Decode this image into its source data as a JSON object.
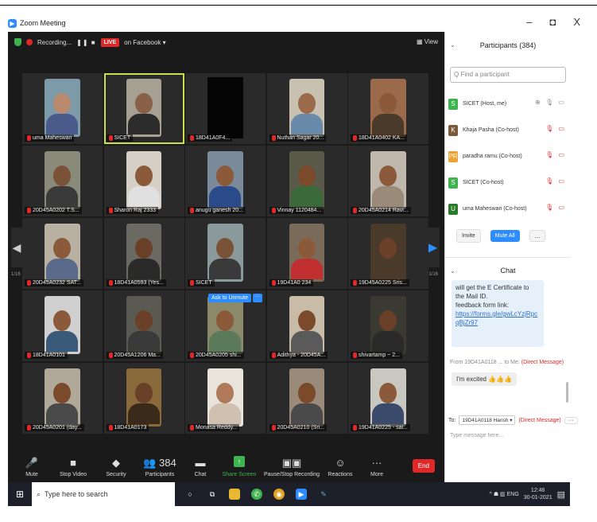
{
  "window": {
    "title": "Zoom Meeting",
    "minimize": "–",
    "maximize": "◘",
    "close": "X"
  },
  "meeting_top": {
    "recording_label": "Recording...",
    "pause_stop": "❚❚ ■",
    "live_badge": "LIVE",
    "live_target": "on Facebook ▾",
    "view_label": "▦ View"
  },
  "nav": {
    "left_page": "1/16",
    "right_page": "1/16",
    "left_arrow": "◀",
    "right_arrow": "▶"
  },
  "tiles": [
    {
      "name": "uma Maheswari",
      "kind": "photo",
      "skin": "#b98a6e",
      "shirt": "#4a5a8a",
      "bg": "#7d9aa8"
    },
    {
      "name": "SICET",
      "kind": "photo",
      "skin": "#8a6048",
      "shirt": "#2c2c2c",
      "bg": "#a6a092",
      "active": true
    },
    {
      "name": "18D41A0F4...",
      "kind": "black"
    },
    {
      "name": "Nuthan Sagar 20...",
      "kind": "photo",
      "skin": "#9a6a4a",
      "shirt": "#6a8aaa",
      "bg": "#c8c0b0"
    },
    {
      "name": "18D41A0402 KA...",
      "kind": "photo",
      "skin": "#8a5a3a",
      "shirt": "#4a3a2a",
      "bg": "#9a6a4a"
    },
    {
      "name": "20D45A0202 T.S...",
      "kind": "photo",
      "skin": "#7a5238",
      "shirt": "#3a3a3a",
      "bg": "#8a8a7a"
    },
    {
      "name": "Sharon Raj 2333",
      "kind": "photo",
      "skin": "#8a5a3a",
      "shirt": "#e0e0e0",
      "bg": "#d6cfc6"
    },
    {
      "name": "anugu ganesh 20...",
      "kind": "photo",
      "skin": "#8a5a3a",
      "shirt": "#2a4a8a",
      "bg": "#7a8a9a"
    },
    {
      "name": "Vinnay 1120484...",
      "kind": "photo",
      "skin": "#7a4a2a",
      "shirt": "#3a6a3a",
      "bg": "#5a5a4a"
    },
    {
      "name": "20D45A0214 Ravi...",
      "kind": "photo",
      "skin": "#8a5a3a",
      "shirt": "#9a8a7a",
      "bg": "#c0b8ac"
    },
    {
      "name": "20D45A0232 SAT...",
      "kind": "photo",
      "skin": "#8a5a3a",
      "shirt": "#5a6a8a",
      "bg": "#b8b0a0"
    },
    {
      "name": "18D41A0593 (Yes...",
      "kind": "photo",
      "skin": "#6a4028",
      "shirt": "#2a2a2a",
      "bg": "#6a6a62"
    },
    {
      "name": "SICET",
      "kind": "photo",
      "skin": "#7a5238",
      "shirt": "#3a3a3a",
      "bg": "#8a9a9a"
    },
    {
      "name": "19D41A0 234",
      "kind": "photo",
      "skin": "#8a5a3a",
      "shirt": "#c03030",
      "bg": "#7a6a5a"
    },
    {
      "name": "19D45A0225 Sris...",
      "kind": "photo",
      "skin": "#6a4028",
      "shirt": "#4a3a2a",
      "bg": "#4a3a2a"
    },
    {
      "name": "18D41A0101",
      "kind": "photo",
      "skin": "#8a5a3a",
      "shirt": "#3a5a7a",
      "bg": "#d0d0d0"
    },
    {
      "name": "20D45A1206 Ma...",
      "kind": "photo",
      "skin": "#6a4028",
      "shirt": "#3a3a3a",
      "bg": "#5a5a52"
    },
    {
      "name": "20D45A0205 shi...",
      "kind": "photo",
      "skin": "#8a5a3a",
      "shirt": "#5a7a5a",
      "bg": "#8a8a6a",
      "unmute": true
    },
    {
      "name": "Adithya - 20D45A...",
      "kind": "photo",
      "skin": "#7a4a2a",
      "shirt": "#5a5a5a",
      "bg": "#c8bca8"
    },
    {
      "name": "shivartamp ~ 2...",
      "kind": "photo",
      "skin": "#6a4028",
      "shirt": "#2a2a2a",
      "bg": "#3a3a32"
    },
    {
      "name": "20D45A0201 (day...",
      "kind": "photo",
      "skin": "#7a4a2a",
      "shirt": "#4a4a4a",
      "bg": "#b0a898"
    },
    {
      "name": "18D41A0173",
      "kind": "photo",
      "skin": "#6a4028",
      "shirt": "#3a2a1a",
      "bg": "#8a6a3a"
    },
    {
      "name": "Monasa Reddy...",
      "kind": "photo",
      "skin": "#b07a5a",
      "shirt": "#d0c0b0",
      "bg": "#e8e4dc"
    },
    {
      "name": "20D45A0210 (Sri...",
      "kind": "photo",
      "skin": "#7a4a2a",
      "shirt": "#4a4a4a",
      "bg": "#9a8a7a"
    },
    {
      "name": "19D41A0225 - sai...",
      "kind": "photo",
      "skin": "#8a5a3a",
      "shirt": "#3a4a6a",
      "bg": "#c8c8c0"
    }
  ],
  "unmute": {
    "label": "Ask to Unmute",
    "more": "···"
  },
  "toolbar": [
    {
      "icon": "🎤",
      "label": "Mute",
      "name": "mute-button"
    },
    {
      "icon": "■",
      "label": "Stop Video",
      "name": "stop-video-button"
    },
    {
      "icon": "◆",
      "label": "Security",
      "name": "security-button"
    },
    {
      "icon": "👥 384",
      "label": "Participants",
      "name": "participants-button"
    },
    {
      "icon": "▬",
      "label": "Chat",
      "name": "chat-button"
    },
    {
      "icon": "↑",
      "label": "Share Screen",
      "name": "share-screen-button",
      "green": true
    },
    {
      "icon": "▣▣",
      "label": "Pause/Stop Recording",
      "name": "pause-stop-recording-button"
    },
    {
      "icon": "☺",
      "label": "Reactions",
      "name": "reactions-button"
    },
    {
      "icon": "···",
      "label": "More",
      "name": "more-button"
    }
  ],
  "end_label": "End",
  "participants": {
    "title": "Participants (384)",
    "collapse": "⌄",
    "search_placeholder": "Q Find a participant",
    "list": [
      {
        "initial": "S",
        "color": "#3fb34f",
        "name": "SICET (Host, me)",
        "icons": "⊕ 🎙 ▭",
        "red": false
      },
      {
        "initial": "K",
        "color": "#7a5a3a",
        "name": "Khaja Pasha (Co-host)",
        "icons": "🎙 ▭",
        "red": true
      },
      {
        "initial": "PR",
        "color": "#f0a030",
        "name": "paradha ramu (Co-host)",
        "icons": "🎙 ▭",
        "red": true
      },
      {
        "initial": "S",
        "color": "#3fb34f",
        "name": "SICET (Co-host)",
        "icons": "🎙 ▭",
        "red": true
      },
      {
        "initial": "U",
        "color": "#2a7a2a",
        "name": "uma Maheswari (Co-host)",
        "icons": "🎙 ▭",
        "red": true
      }
    ],
    "invite": "Invite",
    "mute_all": "Mute All",
    "more": "..."
  },
  "chat": {
    "title": "Chat",
    "collapse": "⌄",
    "bubble_line1": "will get the E Certificate to",
    "bubble_line2": "the Mail ID.",
    "bubble_line3": "feedback form link:",
    "bubble_link": "https://forms.gle/gwLcYzjRpcqBjZr97",
    "meta_from": "From 19D41A0118 ... to Me:",
    "meta_dm": "(Direct Message)",
    "message": "I'm excited 👍👍👍",
    "to_label": "To:",
    "to_select": "19D41A0118 Harish ▾",
    "to_dm": "(Direct Message)",
    "to_more": "···",
    "input_placeholder": "Type message here..."
  },
  "taskbar": {
    "start": "⊞",
    "search_placeholder": "Type here to search",
    "tray_text": "^ ☗ ▥ ENG",
    "time": "12:46",
    "date": "30-01-2021",
    "notify": "▤"
  }
}
